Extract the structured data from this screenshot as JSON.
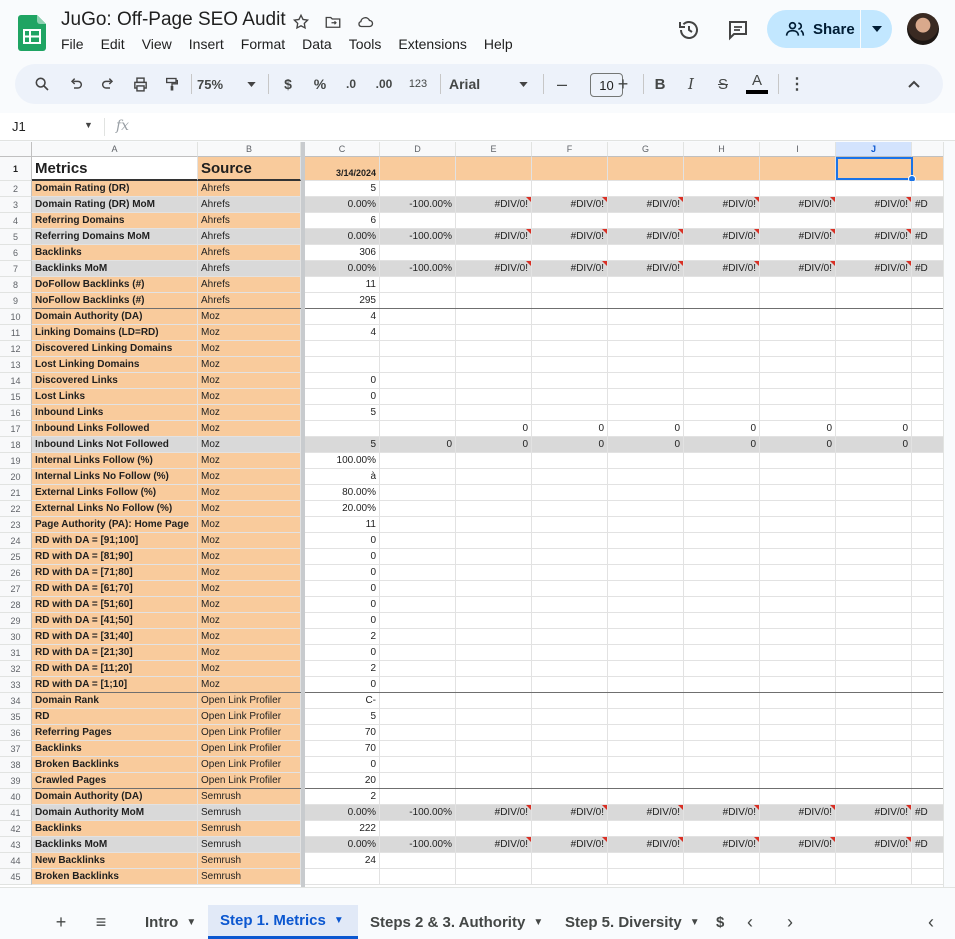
{
  "app": {
    "title": "JuGo: Off-Page SEO Audit",
    "menu": [
      "File",
      "Edit",
      "View",
      "Insert",
      "Format",
      "Data",
      "Tools",
      "Extensions",
      "Help"
    ],
    "share_label": "Share"
  },
  "toolbar": {
    "zoom": "75%",
    "currency": "$",
    "percent": "%",
    "dec_decrease": ".0",
    "dec_increase": ".00",
    "number_format": "123",
    "font": "Arial",
    "font_size": "10",
    "minus": "–",
    "plus": "+",
    "bold": "B",
    "italic": "I",
    "strike": "S",
    "text_color": "A",
    "more": "⋮",
    "collapse": "^"
  },
  "formula_bar": {
    "name_box": "J1",
    "fx": "fx"
  },
  "sheet": {
    "columns": [
      "A",
      "B",
      "C",
      "D",
      "E",
      "F",
      "G",
      "H",
      "I",
      "J"
    ],
    "selected_column": "J",
    "header_row": {
      "a": "Metrics",
      "b": "Source",
      "c": "3/14/2024"
    },
    "rows": [
      {
        "n": "2",
        "a": "Domain Rating (DR)",
        "b": "Ahrefs",
        "c": "5",
        "v": []
      },
      {
        "n": "3",
        "a": "Domain Rating (DR) MoM",
        "b": "Ahrefs",
        "c": "0.00%",
        "v": [
          "-100.00%",
          "#DIV/0!",
          "#DIV/0!",
          "#DIV/0!",
          "#DIV/0!",
          "#DIV/0!",
          "#DIV/0!",
          "#D"
        ],
        "gray": true,
        "err": true
      },
      {
        "n": "4",
        "a": "Referring Domains",
        "b": "Ahrefs",
        "c": "6",
        "v": []
      },
      {
        "n": "5",
        "a": "Referring Domains MoM",
        "b": "Ahrefs",
        "c": "0.00%",
        "v": [
          "-100.00%",
          "#DIV/0!",
          "#DIV/0!",
          "#DIV/0!",
          "#DIV/0!",
          "#DIV/0!",
          "#DIV/0!",
          "#D"
        ],
        "gray": true,
        "err": true
      },
      {
        "n": "6",
        "a": "Backlinks",
        "b": "Ahrefs",
        "c": "306",
        "v": []
      },
      {
        "n": "7",
        "a": "Backlinks MoM",
        "b": "Ahrefs",
        "c": "0.00%",
        "v": [
          "-100.00%",
          "#DIV/0!",
          "#DIV/0!",
          "#DIV/0!",
          "#DIV/0!",
          "#DIV/0!",
          "#DIV/0!",
          "#D"
        ],
        "gray": true,
        "err": true
      },
      {
        "n": "8",
        "a": "DoFollow Backlinks (#)",
        "b": "Ahrefs",
        "c": "11",
        "v": []
      },
      {
        "n": "9",
        "a": "NoFollow Backlinks (#)",
        "b": "Ahrefs",
        "c": "295",
        "v": []
      },
      {
        "n": "10",
        "a": "Domain Authority (DA)",
        "b": "Moz",
        "c": "4",
        "v": [],
        "sec": true
      },
      {
        "n": "11",
        "a": "Linking Domains (LD=RD)",
        "b": "Moz",
        "c": "4",
        "v": []
      },
      {
        "n": "12",
        "a": "Discovered Linking Domains",
        "b": "Moz",
        "c": "",
        "v": []
      },
      {
        "n": "13",
        "a": "Lost Linking Domains",
        "b": "Moz",
        "c": "",
        "v": []
      },
      {
        "n": "14",
        "a": "Discovered Links",
        "b": "Moz",
        "c": "0",
        "v": []
      },
      {
        "n": "15",
        "a": "Lost Links",
        "b": "Moz",
        "c": "0",
        "v": []
      },
      {
        "n": "16",
        "a": "Inbound Links",
        "b": "Moz",
        "c": "5",
        "v": []
      },
      {
        "n": "17",
        "a": "Inbound Links Followed",
        "b": "Moz",
        "c": "",
        "v": [
          "",
          "0",
          "0",
          "0",
          "0",
          "0",
          "0",
          ""
        ]
      },
      {
        "n": "18",
        "a": "Inbound Links Not Followed",
        "b": "Moz",
        "c": "5",
        "v": [
          "0",
          "0",
          "0",
          "0",
          "0",
          "0",
          "0",
          ""
        ],
        "gray": true
      },
      {
        "n": "19",
        "a": "Internal Links Follow (%)",
        "b": "Moz",
        "c": "100.00%",
        "v": []
      },
      {
        "n": "20",
        "a": "Internal Links No Follow (%)",
        "b": "Moz",
        "c": "à",
        "v": []
      },
      {
        "n": "21",
        "a": "External Links Follow (%)",
        "b": "Moz",
        "c": "80.00%",
        "v": []
      },
      {
        "n": "22",
        "a": "External Links No Follow (%)",
        "b": "Moz",
        "c": "20.00%",
        "v": []
      },
      {
        "n": "23",
        "a": "Page Authority (PA): Home Page",
        "b": "Moz",
        "c": "11",
        "v": []
      },
      {
        "n": "24",
        "a": "RD with DA = [91;100]",
        "b": "Moz",
        "c": "0",
        "v": []
      },
      {
        "n": "25",
        "a": "RD with DA = [81;90]",
        "b": "Moz",
        "c": "0",
        "v": []
      },
      {
        "n": "26",
        "a": "RD with DA = [71;80]",
        "b": "Moz",
        "c": "0",
        "v": []
      },
      {
        "n": "27",
        "a": "RD with DA = [61;70]",
        "b": "Moz",
        "c": "0",
        "v": []
      },
      {
        "n": "28",
        "a": "RD with DA = [51;60]",
        "b": "Moz",
        "c": "0",
        "v": []
      },
      {
        "n": "29",
        "a": "RD with DA = [41;50]",
        "b": "Moz",
        "c": "0",
        "v": []
      },
      {
        "n": "30",
        "a": "RD with DA = [31;40]",
        "b": "Moz",
        "c": "2",
        "v": []
      },
      {
        "n": "31",
        "a": "RD with DA = [21;30]",
        "b": "Moz",
        "c": "0",
        "v": []
      },
      {
        "n": "32",
        "a": "RD with DA = [11;20]",
        "b": "Moz",
        "c": "2",
        "v": []
      },
      {
        "n": "33",
        "a": "RD with DA = [1;10]",
        "b": "Moz",
        "c": "0",
        "v": []
      },
      {
        "n": "34",
        "a": "Domain Rank",
        "b": "Open Link Profiler",
        "c": "C-",
        "v": [],
        "sec": true
      },
      {
        "n": "35",
        "a": "RD",
        "b": "Open Link Profiler",
        "c": "5",
        "v": []
      },
      {
        "n": "36",
        "a": "Referring Pages",
        "b": "Open Link Profiler",
        "c": "70",
        "v": []
      },
      {
        "n": "37",
        "a": "Backlinks",
        "b": "Open Link Profiler",
        "c": "70",
        "v": []
      },
      {
        "n": "38",
        "a": "Broken Backlinks",
        "b": "Open Link Profiler",
        "c": "0",
        "v": []
      },
      {
        "n": "39",
        "a": "Crawled Pages",
        "b": "Open Link Profiler",
        "c": "20",
        "v": []
      },
      {
        "n": "40",
        "a": "Domain Authority (DA)",
        "b": "Semrush",
        "c": "2",
        "v": [],
        "sec": true
      },
      {
        "n": "41",
        "a": "Domain Authority MoM",
        "b": "Semrush",
        "c": "0.00%",
        "v": [
          "-100.00%",
          "#DIV/0!",
          "#DIV/0!",
          "#DIV/0!",
          "#DIV/0!",
          "#DIV/0!",
          "#DIV/0!",
          "#D"
        ],
        "gray": true,
        "err": true
      },
      {
        "n": "42",
        "a": "Backlinks",
        "b": "Semrush",
        "c": "222",
        "v": []
      },
      {
        "n": "43",
        "a": "Backlinks MoM",
        "b": "Semrush",
        "c": "0.00%",
        "v": [
          "-100.00%",
          "#DIV/0!",
          "#DIV/0!",
          "#DIV/0!",
          "#DIV/0!",
          "#DIV/0!",
          "#DIV/0!",
          "#D"
        ],
        "gray": true,
        "err": true
      },
      {
        "n": "44",
        "a": "New Backlinks",
        "b": "Semrush",
        "c": "24",
        "v": []
      },
      {
        "n": "45",
        "a": "Broken Backlinks",
        "b": "Semrush",
        "c": "",
        "v": []
      }
    ]
  },
  "tabs": [
    {
      "label": "Intro",
      "active": false
    },
    {
      "label": "Step 1. Metrics",
      "active": true
    },
    {
      "label": "Steps 2 & 3. Authority",
      "active": false
    },
    {
      "label": "Step 5. Diversity",
      "active": false
    },
    {
      "label": "$",
      "active": false
    }
  ],
  "colors": {
    "peach": "#f9cb9c",
    "gray": "#d9d9d9",
    "accent": "#0b57d0",
    "share_bg": "#c2e7ff",
    "error": "#d93025"
  }
}
